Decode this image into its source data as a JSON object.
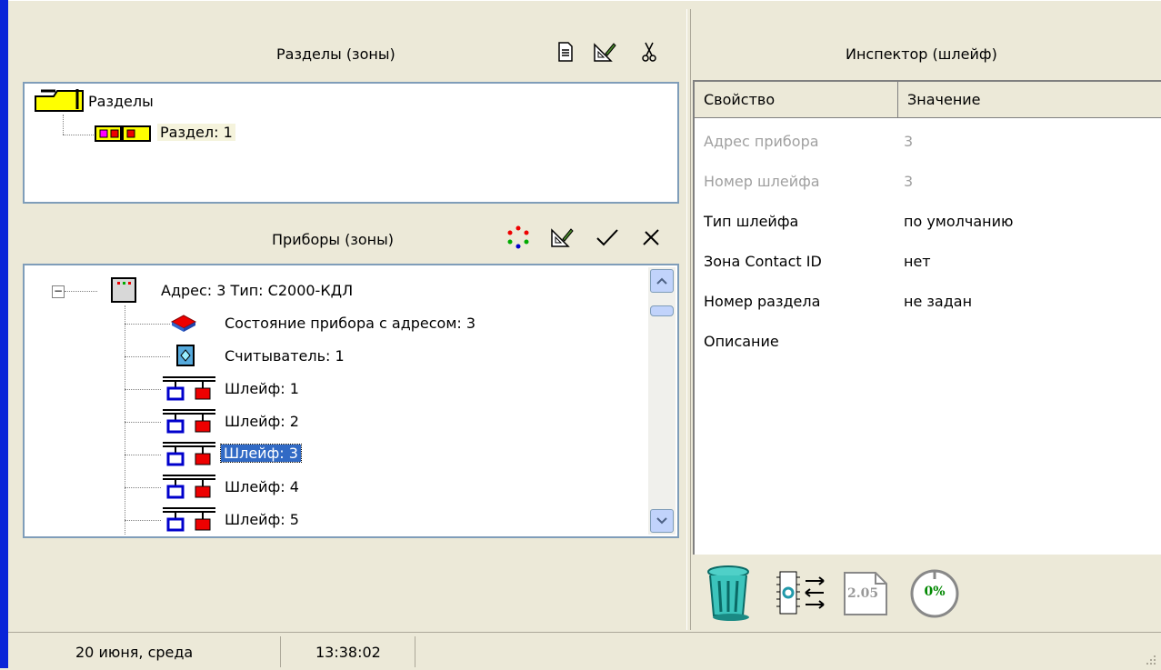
{
  "partitions_panel": {
    "title": "Разделы (зоны)",
    "root_label": "Разделы",
    "child_label": "Раздел: 1",
    "icons": [
      "new-document-icon",
      "edit-ruler-icon",
      "scissors-icon"
    ]
  },
  "devices_panel": {
    "title": "Приборы  (зоны)",
    "icons": [
      "refresh-cycle-icon",
      "edit-ruler-icon",
      "checkmark-icon",
      "cross-icon"
    ],
    "device_label": "Адрес: 3 Тип: С2000-КДЛ",
    "items": [
      "Состояние прибора с адресом: 3",
      "Считыватель: 1",
      "Шлейф: 1",
      "Шлейф: 2",
      "Шлейф: 3",
      "Шлейф: 4",
      "Шлейф: 5"
    ],
    "selected_item": "Шлейф: 3"
  },
  "inspector": {
    "title": "Инспектор (шлейф)",
    "col_property": "Свойство",
    "col_value": "Значение",
    "rows": [
      {
        "property": "Адрес прибора",
        "value": "3",
        "disabled": true
      },
      {
        "property": "Номер шлейфа",
        "value": "3",
        "disabled": true
      },
      {
        "property": "Тип шлейфа",
        "value": "по умолчанию",
        "disabled": false
      },
      {
        "property": "Зона Contact ID",
        "value": "нет",
        "disabled": false
      },
      {
        "property": "Номер раздела",
        "value": "не задан",
        "disabled": false
      },
      {
        "property": "Описание",
        "value": "",
        "disabled": false
      }
    ],
    "bottom_icons": [
      "trash-icon",
      "chip-transfer-icon",
      "version-file-icon",
      "progress-icon"
    ],
    "version_text": "2.05",
    "progress_text": "0%"
  },
  "statusbar": {
    "date": "20 июня, среда",
    "time": "13:38:02"
  },
  "colors": {
    "accent": "#0a24d8",
    "selection": "#316ac5",
    "panel_bg": "#ece9d8",
    "tree_border": "#7f9db9"
  }
}
